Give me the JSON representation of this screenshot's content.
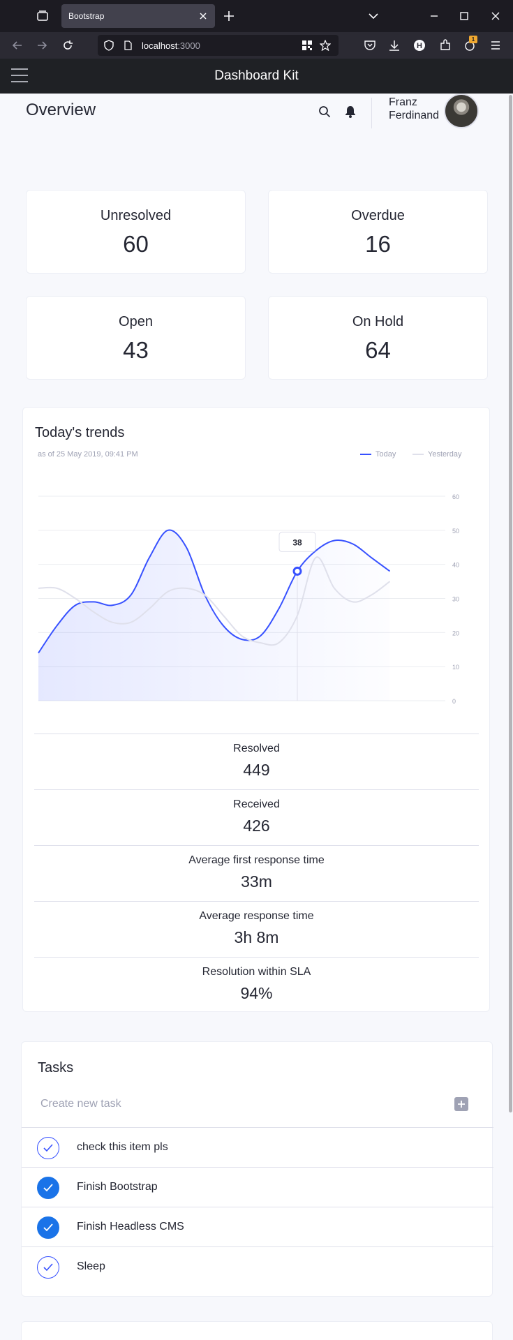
{
  "browser": {
    "tab_title": "Bootstrap",
    "url_host": "localhost",
    "url_port": ":3000",
    "extension_badge": "1"
  },
  "app": {
    "title": "Dashboard Kit",
    "page_title": "Overview",
    "user_name_line1": "Franz",
    "user_name_line2": "Ferdinand"
  },
  "stats": [
    {
      "label": "Unresolved",
      "value": "60"
    },
    {
      "label": "Overdue",
      "value": "16"
    },
    {
      "label": "Open",
      "value": "43"
    },
    {
      "label": "On Hold",
      "value": "64"
    }
  ],
  "trends": {
    "title": "Today's trends",
    "subtitle": "as of 25 May 2019, 09:41 PM",
    "legend_today": "Today",
    "legend_yesterday": "Yesterday",
    "tooltip": "38"
  },
  "chart_data": {
    "type": "area",
    "x": [
      0,
      1,
      2,
      3,
      4,
      5,
      6,
      7,
      8,
      9,
      10,
      11,
      12,
      13,
      14,
      15,
      16,
      17,
      18,
      19,
      20,
      21,
      22
    ],
    "y_ticks": [
      0,
      10,
      20,
      30,
      40,
      50,
      60
    ],
    "ylim": [
      0,
      60
    ],
    "series": [
      {
        "name": "Today",
        "color": "#3751ff",
        "x": [
          0,
          1,
          2,
          3,
          4,
          5,
          6,
          7,
          8,
          9,
          10,
          11,
          12,
          13,
          14,
          15,
          16,
          17,
          18,
          19
        ],
        "values": [
          14,
          22,
          28,
          29,
          28,
          31,
          42,
          50,
          45,
          31,
          22,
          18,
          19,
          27,
          38,
          44,
          47,
          46,
          42,
          38
        ]
      },
      {
        "name": "Yesterday",
        "color": "#dfe0eb",
        "x": [
          0,
          1,
          2,
          3,
          4,
          5,
          6,
          7,
          8,
          9,
          10,
          11,
          12,
          13,
          14,
          15,
          16,
          17,
          18,
          19
        ],
        "values": [
          33,
          33,
          30,
          26,
          23,
          23,
          27,
          32,
          33,
          31,
          25,
          19,
          17,
          17,
          25,
          42,
          33,
          29,
          31,
          35
        ]
      }
    ],
    "tooltip_point": {
      "x": 14,
      "y": 38
    }
  },
  "metrics": [
    {
      "label": "Resolved",
      "value": "449"
    },
    {
      "label": "Received",
      "value": "426"
    },
    {
      "label": "Average first response time",
      "value": "33m"
    },
    {
      "label": "Average response time",
      "value": "3h 8m"
    },
    {
      "label": "Resolution within SLA",
      "value": "94%"
    }
  ],
  "tasks": {
    "title": "Tasks",
    "create_placeholder": "Create new task",
    "items": [
      {
        "label": "check this item pls",
        "done": false
      },
      {
        "label": "Finish Bootstrap",
        "done": true
      },
      {
        "label": "Finish Headless CMS",
        "done": true
      },
      {
        "label": "Sleep",
        "done": false
      }
    ]
  }
}
